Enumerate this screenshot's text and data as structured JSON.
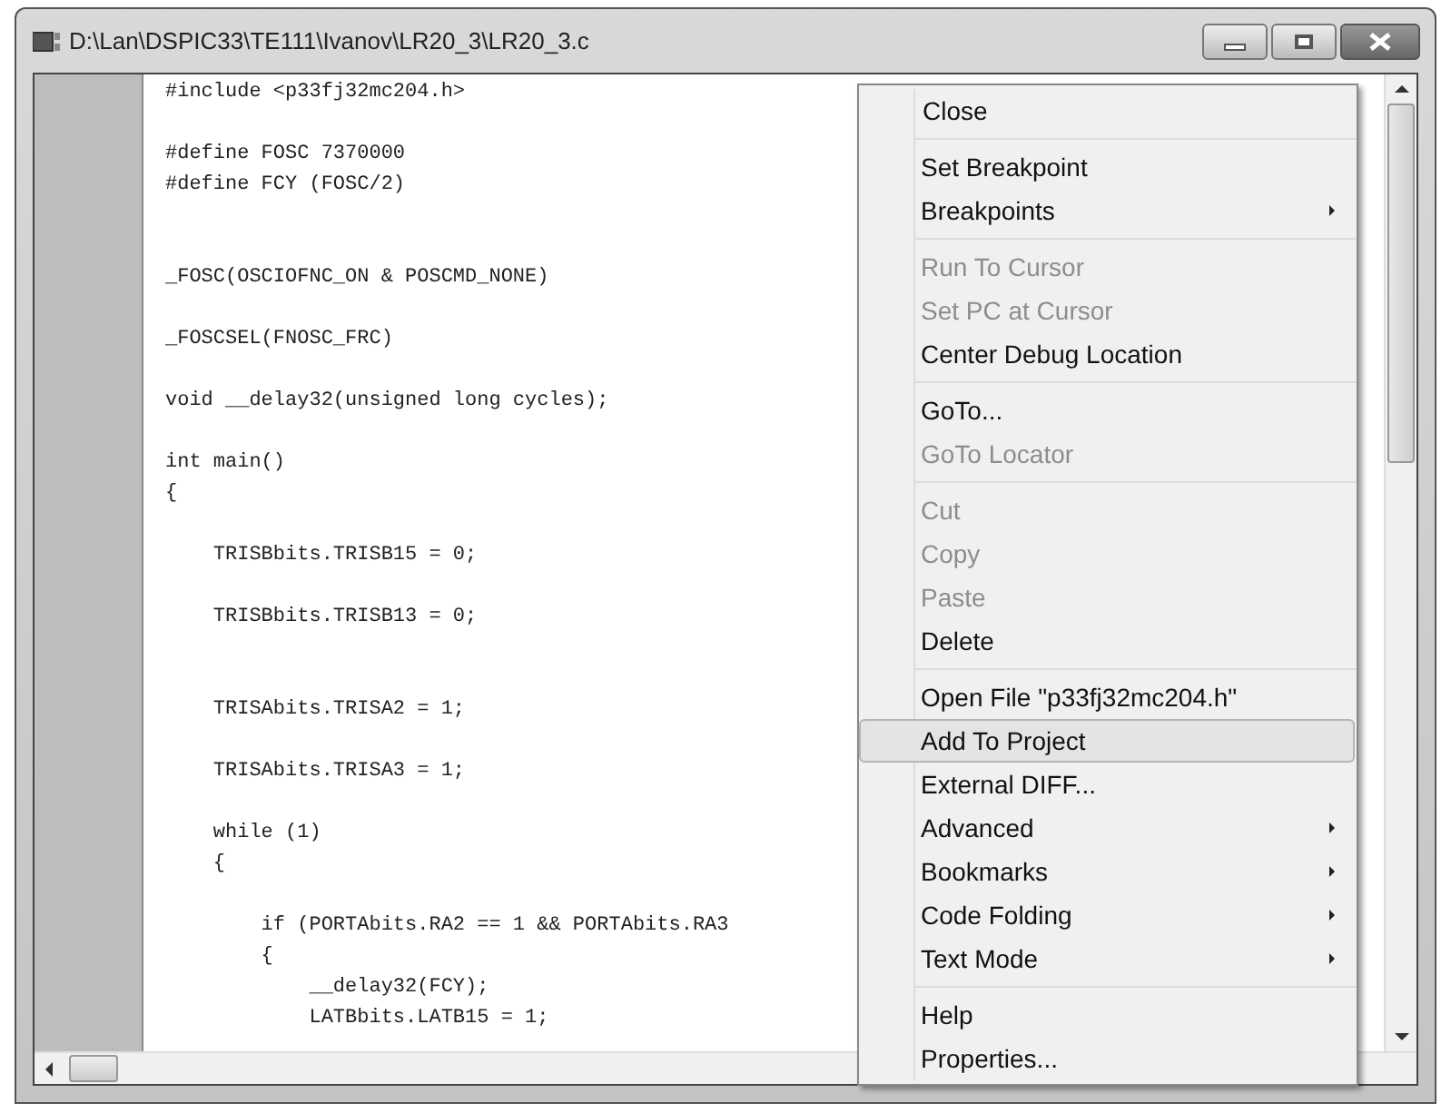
{
  "window": {
    "title": "D:\\Lan\\DSPIC33\\TE111\\Ivanov\\LR20_3\\LR20_3.c"
  },
  "code_lines": [
    {
      "kind": "code",
      "text": "#include <p33fj32mc204.h>"
    },
    {
      "kind": "blank"
    },
    {
      "kind": "code",
      "text": "#define FOSC 7370000"
    },
    {
      "kind": "code",
      "text": "#define FCY (FOSC/2)"
    },
    {
      "kind": "blank"
    },
    {
      "kind": "blank"
    },
    {
      "kind": "code",
      "text": "_FOSC(OSCIOFNC_ON & POSCMD_NONE)"
    },
    {
      "kind": "blank"
    },
    {
      "kind": "code",
      "text": "_FOSCSEL(FNOSC_FRC)"
    },
    {
      "kind": "blank"
    },
    {
      "kind": "code",
      "text": "void __delay32(unsigned long cycles);"
    },
    {
      "kind": "blank"
    },
    {
      "kind": "code",
      "text": "int main()"
    },
    {
      "kind": "code",
      "text": "{"
    },
    {
      "kind": "blank"
    },
    {
      "kind": "code",
      "text": "    TRISBbits.TRISB15 = 0;"
    },
    {
      "kind": "blank"
    },
    {
      "kind": "code",
      "text": "    TRISBbits.TRISB13 = 0;"
    },
    {
      "kind": "blank"
    },
    {
      "kind": "blank"
    },
    {
      "kind": "code",
      "text": "    TRISAbits.TRISA2 = 1;"
    },
    {
      "kind": "blank"
    },
    {
      "kind": "code",
      "text": "    TRISAbits.TRISA3 = 1;"
    },
    {
      "kind": "blank"
    },
    {
      "kind": "code",
      "text": "    while (1)"
    },
    {
      "kind": "code",
      "text": "    {"
    },
    {
      "kind": "blank"
    },
    {
      "kind": "code",
      "text": "        if (PORTAbits.RA2 == 1 && PORTAbits.RA3"
    },
    {
      "kind": "code",
      "text": "        {"
    },
    {
      "kind": "code",
      "text": "            __delay32(FCY);"
    },
    {
      "kind": "code",
      "text": "            LATBbits.LATB15 = 1;"
    }
  ],
  "context_menu": {
    "groups": [
      [
        {
          "label": "Close",
          "disabled": false,
          "submenu": false,
          "selected": false
        }
      ],
      [
        {
          "label": "Set Breakpoint",
          "disabled": false,
          "submenu": false,
          "selected": false
        },
        {
          "label": "Breakpoints",
          "disabled": false,
          "submenu": true,
          "selected": false
        }
      ],
      [
        {
          "label": "Run To Cursor",
          "disabled": true,
          "submenu": false,
          "selected": false
        },
        {
          "label": "Set PC at Cursor",
          "disabled": true,
          "submenu": false,
          "selected": false
        },
        {
          "label": "Center Debug Location",
          "disabled": false,
          "submenu": false,
          "selected": false
        }
      ],
      [
        {
          "label": "GoTo...",
          "disabled": false,
          "submenu": false,
          "selected": false
        },
        {
          "label": "GoTo Locator",
          "disabled": true,
          "submenu": false,
          "selected": false
        }
      ],
      [
        {
          "label": "Cut",
          "disabled": true,
          "submenu": false,
          "selected": false
        },
        {
          "label": "Copy",
          "disabled": true,
          "submenu": false,
          "selected": false
        },
        {
          "label": "Paste",
          "disabled": true,
          "submenu": false,
          "selected": false
        },
        {
          "label": "Delete",
          "disabled": false,
          "submenu": false,
          "selected": false
        }
      ],
      [
        {
          "label": "Open File \"p33fj32mc204.h\"",
          "disabled": false,
          "submenu": false,
          "selected": false
        },
        {
          "label": "Add To Project",
          "disabled": false,
          "submenu": false,
          "selected": true
        },
        {
          "label": "External DIFF...",
          "disabled": false,
          "submenu": false,
          "selected": false
        },
        {
          "label": "Advanced",
          "disabled": false,
          "submenu": true,
          "selected": false
        },
        {
          "label": "Bookmarks",
          "disabled": false,
          "submenu": true,
          "selected": false
        },
        {
          "label": "Code Folding",
          "disabled": false,
          "submenu": true,
          "selected": false
        },
        {
          "label": "Text Mode",
          "disabled": false,
          "submenu": true,
          "selected": false
        }
      ],
      [
        {
          "label": "Help",
          "disabled": false,
          "submenu": false,
          "selected": false
        },
        {
          "label": "Properties...",
          "disabled": false,
          "submenu": false,
          "selected": false
        }
      ]
    ]
  }
}
